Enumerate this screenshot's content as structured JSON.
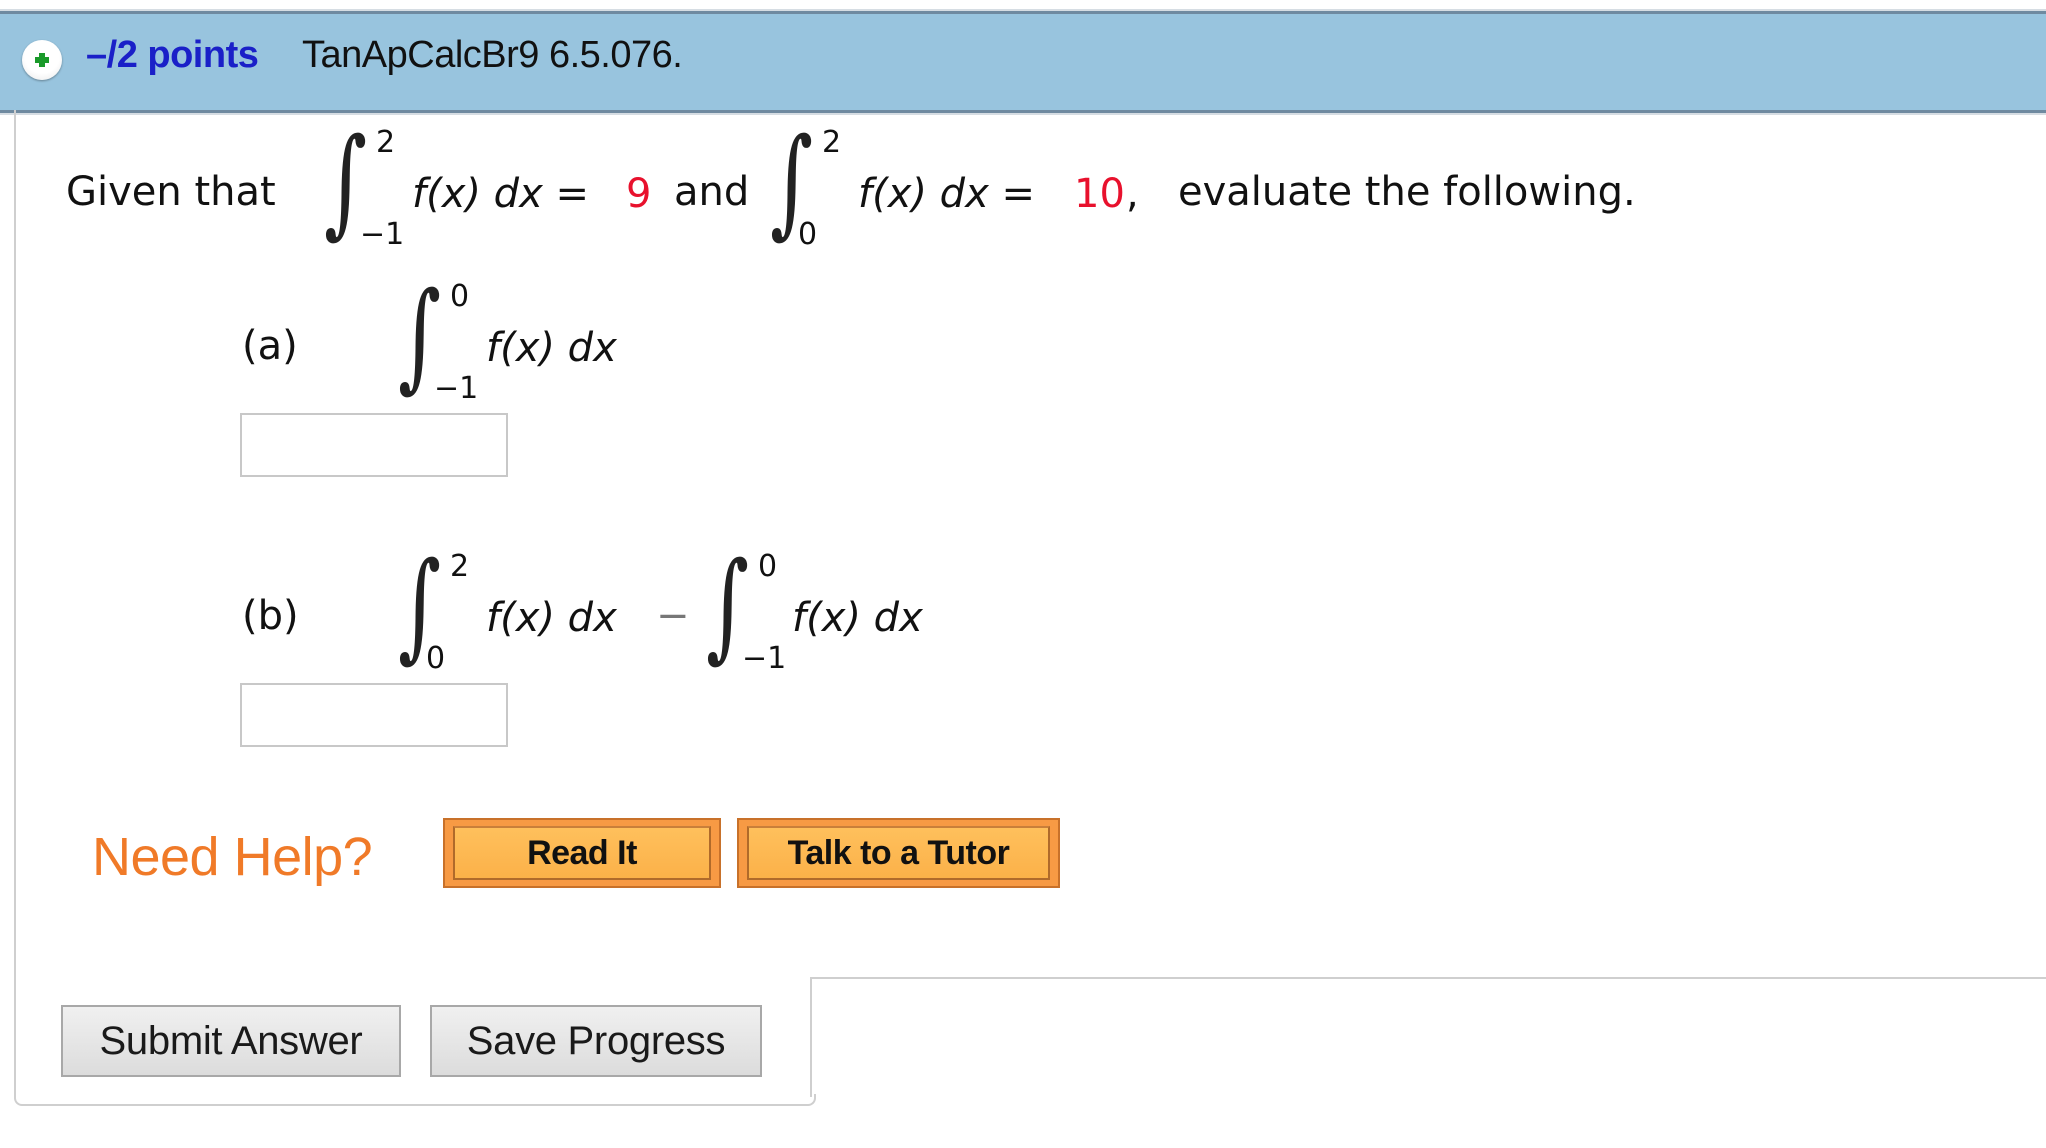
{
  "header": {
    "expand_icon": "plus-circle-icon",
    "points_label": "–/2 points",
    "question_id": "TanApCalcBr9 6.5.076."
  },
  "question": {
    "intro": "Given that",
    "given1": {
      "upper": "2",
      "lower": "−1",
      "integrand": "f(x) dx =",
      "value": "9"
    },
    "connector": "and",
    "given2": {
      "upper": "2",
      "lower": "0",
      "integrand": "f(x) dx =",
      "value": "10"
    },
    "comma": ",",
    "instruction": "evaluate the following.",
    "parts": [
      {
        "label": "(a)",
        "integral1": {
          "upper": "0",
          "lower": "−1",
          "integrand": "f(x) dx"
        },
        "answer_value": ""
      },
      {
        "label": "(b)",
        "integral1": {
          "upper": "2",
          "lower": "0",
          "integrand": "f(x) dx"
        },
        "operator": "−",
        "integral2": {
          "upper": "0",
          "lower": "−1",
          "integrand": "f(x) dx"
        },
        "answer_value": ""
      }
    ]
  },
  "help": {
    "label": "Need Help?",
    "buttons": [
      "Read It",
      "Talk to a Tutor"
    ]
  },
  "actions": {
    "submit_label": "Submit Answer",
    "save_label": "Save Progress"
  },
  "colors": {
    "header_bg": "#98c4de",
    "points_blue": "#1a20c8",
    "given_value_red": "#e8112d",
    "help_orange": "#f07a28",
    "help_button_bg": "#fbb149"
  }
}
